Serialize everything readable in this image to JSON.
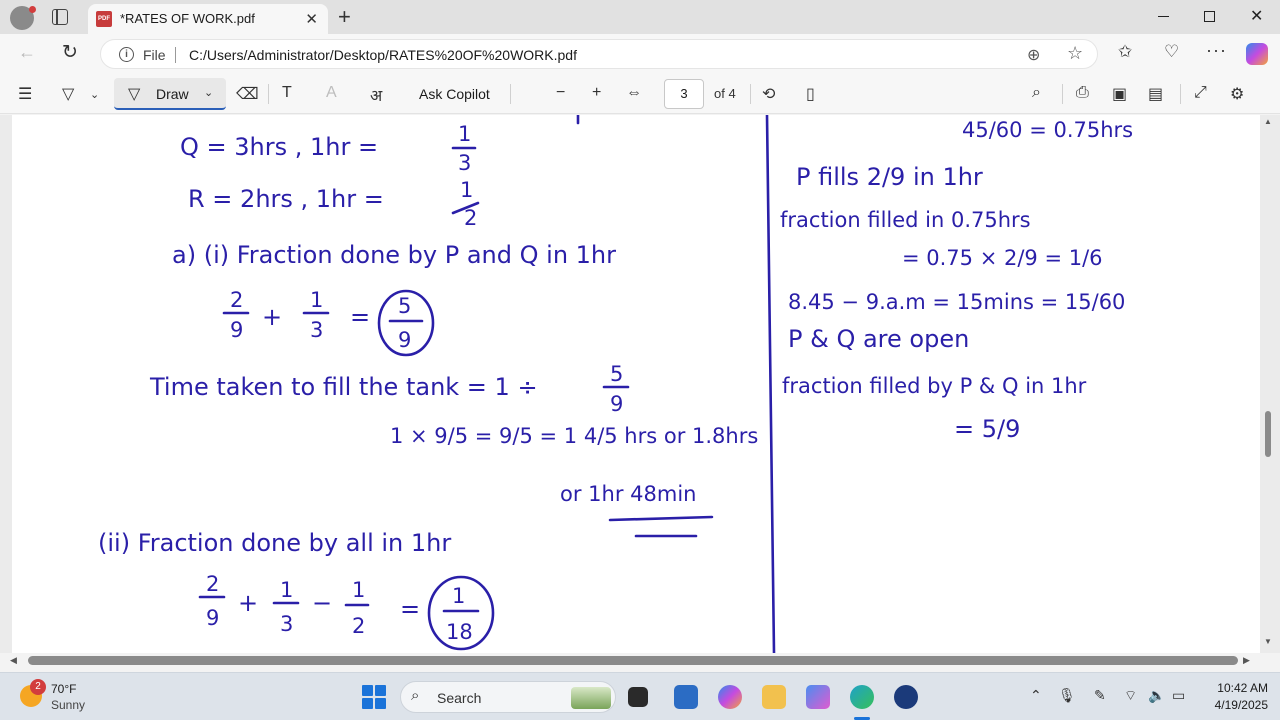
{
  "browser": {
    "tab_title": "*RATES OF WORK.pdf",
    "tab_icon": "pdf-icon",
    "address": {
      "scheme_label": "File",
      "url": "C:/Users/Administrator/Desktop/RATES%20OF%20WORK.pdf"
    }
  },
  "pdf_toolbar": {
    "draw_label": "Draw",
    "ask_copilot_label": "Ask Copilot",
    "current_page": "3",
    "page_of_label": "of 4"
  },
  "document": {
    "left_column": {
      "line_q": "Q = 3hrs , 1hr =",
      "line_q_frac": [
        "1",
        "3"
      ],
      "line_r": "R = 2hrs , 1hr =",
      "line_r_frac": [
        "1",
        "2"
      ],
      "part_a_heading": "a) (i) Fraction done by P and Q in 1hr",
      "sum_pq": {
        "a": [
          "2",
          "9"
        ],
        "b": [
          "1",
          "3"
        ],
        "result": [
          "5",
          "9"
        ]
      },
      "time_taken_label": "Time taken to fill the tank = 1 ÷",
      "time_taken_frac": [
        "5",
        "9"
      ],
      "calc_line": "1 × 9/5 = 9/5 = 1 4/5 hrs or 1.8hrs",
      "or_line": "or 1hr 48min",
      "part_ii_heading": "(ii) Fraction done by all in 1hr",
      "sum_all": {
        "a": [
          "2",
          "9"
        ],
        "b": [
          "1",
          "3"
        ],
        "c": [
          "1",
          "2"
        ],
        "result": [
          "1",
          "18"
        ]
      }
    },
    "right_column": {
      "top_line": "45/60 = 0.75hrs",
      "p_fills": "P fills 2/9 in 1hr",
      "fraction_filled": "fraction filled in 0.75hrs",
      "calc": "= 0.75 × 2/9 = 1/6",
      "time_range": "8.45 − 9.a.m = 15mins = 15/60",
      "pq_open": "P & Q are open",
      "fraction_pq": "fraction filled by P & Q in 1hr",
      "result": "= 5/9"
    }
  },
  "taskbar": {
    "weather_badge": "2",
    "temperature": "70°F",
    "condition": "Sunny",
    "search_label": "Search",
    "time": "10:42 AM",
    "date": "4/19/2025"
  },
  "colors": {
    "ink": "#2a1fa8",
    "accent": "#1a73d9"
  }
}
